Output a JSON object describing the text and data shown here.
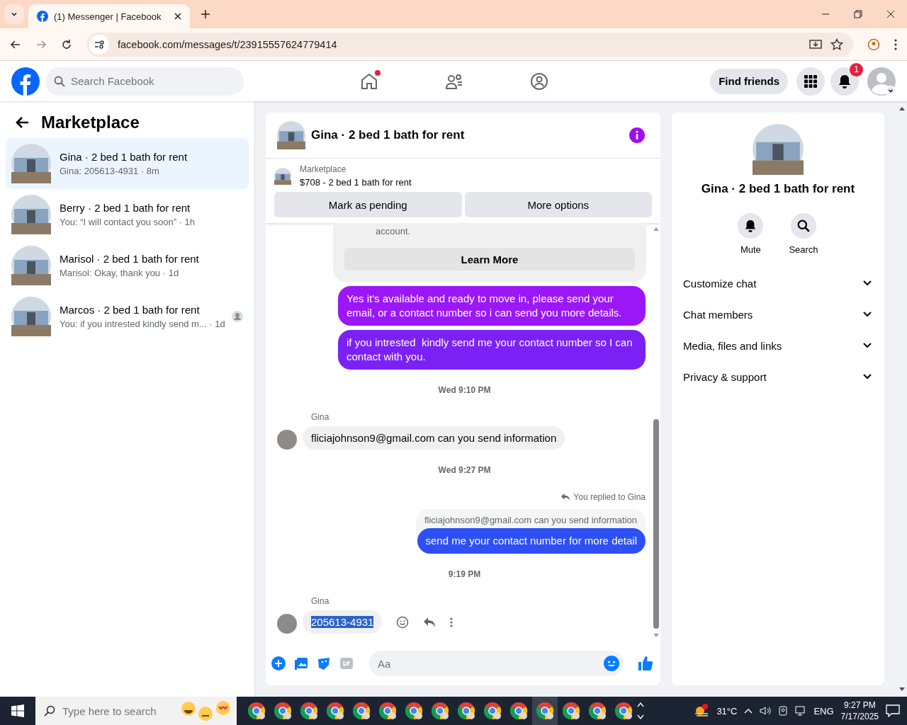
{
  "browser": {
    "tab_title": "(1) Messenger | Facebook",
    "address": "facebook.com/messages/t/23915557624779414"
  },
  "header": {
    "search_placeholder": "Search Facebook",
    "find_friends": "Find friends",
    "notification_count": "1",
    "home_badge": true
  },
  "sidebar": {
    "title": "Marketplace",
    "conversations": [
      {
        "name": "Gina · 2 bed 1 bath for rent",
        "preview": "Gina: 205613-4931 · 8m",
        "selected": true,
        "read_receipt": false
      },
      {
        "name": "Berry · 2 bed 1 bath for rent",
        "preview": "You: “I will contact you soon” · 1h",
        "selected": false,
        "read_receipt": false
      },
      {
        "name": "Marisol · 2 bed 1 bath for rent",
        "preview": "Marisol: Okay, thank you · 1d",
        "selected": false,
        "read_receipt": false
      },
      {
        "name": "Marcos · 2 bed 1 bath for rent",
        "preview": "You: if you intrested kindly send m...  · 1d",
        "selected": false,
        "read_receipt": true
      }
    ]
  },
  "chat": {
    "title": "Gina · 2 bed 1 bath for rent",
    "listing": {
      "label": "Marketplace",
      "title": "$708 - 2 bed 1 bath for rent"
    },
    "actions": [
      "Mark as pending",
      "More options"
    ],
    "messages": [
      {
        "kind": "notice",
        "text": "account.",
        "button": "Learn More"
      },
      {
        "kind": "outgoing",
        "text": "Yes it's available and ready to move in, please send your email, or a contact number so i can send you more details.",
        "color": "#9b17f8"
      },
      {
        "kind": "outgoing",
        "text": "if you intrested  kindly send me your contact number so I can contact with you.",
        "color": "#7b21f6"
      },
      {
        "kind": "timestamp",
        "text": "Wed 9:10 PM"
      },
      {
        "kind": "incoming",
        "sender": "Gina",
        "text": "fliciajohnson9@gmail.com can you send information",
        "highlighted": false
      },
      {
        "kind": "timestamp",
        "text": "Wed 9:27 PM"
      },
      {
        "kind": "reply",
        "label": "You replied to Gina",
        "quoted": "fliciajohnson9@gmail.com can you send information",
        "text": "send me your contact number for more detail",
        "color": "#2d50f5"
      },
      {
        "kind": "timestamp",
        "text": "9:19 PM"
      },
      {
        "kind": "incoming",
        "sender": "Gina",
        "text": "205613-4931",
        "highlighted": true
      }
    ],
    "composer_placeholder": "Aa"
  },
  "details": {
    "title": "Gina · 2 bed 1 bath for rent",
    "actions": [
      {
        "kind": "bell",
        "label": "Mute"
      },
      {
        "kind": "search",
        "label": "Search"
      }
    ],
    "sections": [
      {
        "label": "Customize chat",
        "expanded": false
      },
      {
        "label": "Chat members",
        "expanded": false
      },
      {
        "label": "Media, files and links",
        "expanded": false
      },
      {
        "label": "Privacy & support",
        "expanded": false
      }
    ]
  },
  "taskbar": {
    "search_placeholder": "Type here to search",
    "temperature": "31°C",
    "language": "ENG",
    "time": "9:27 PM",
    "date": "7/17/2025"
  }
}
